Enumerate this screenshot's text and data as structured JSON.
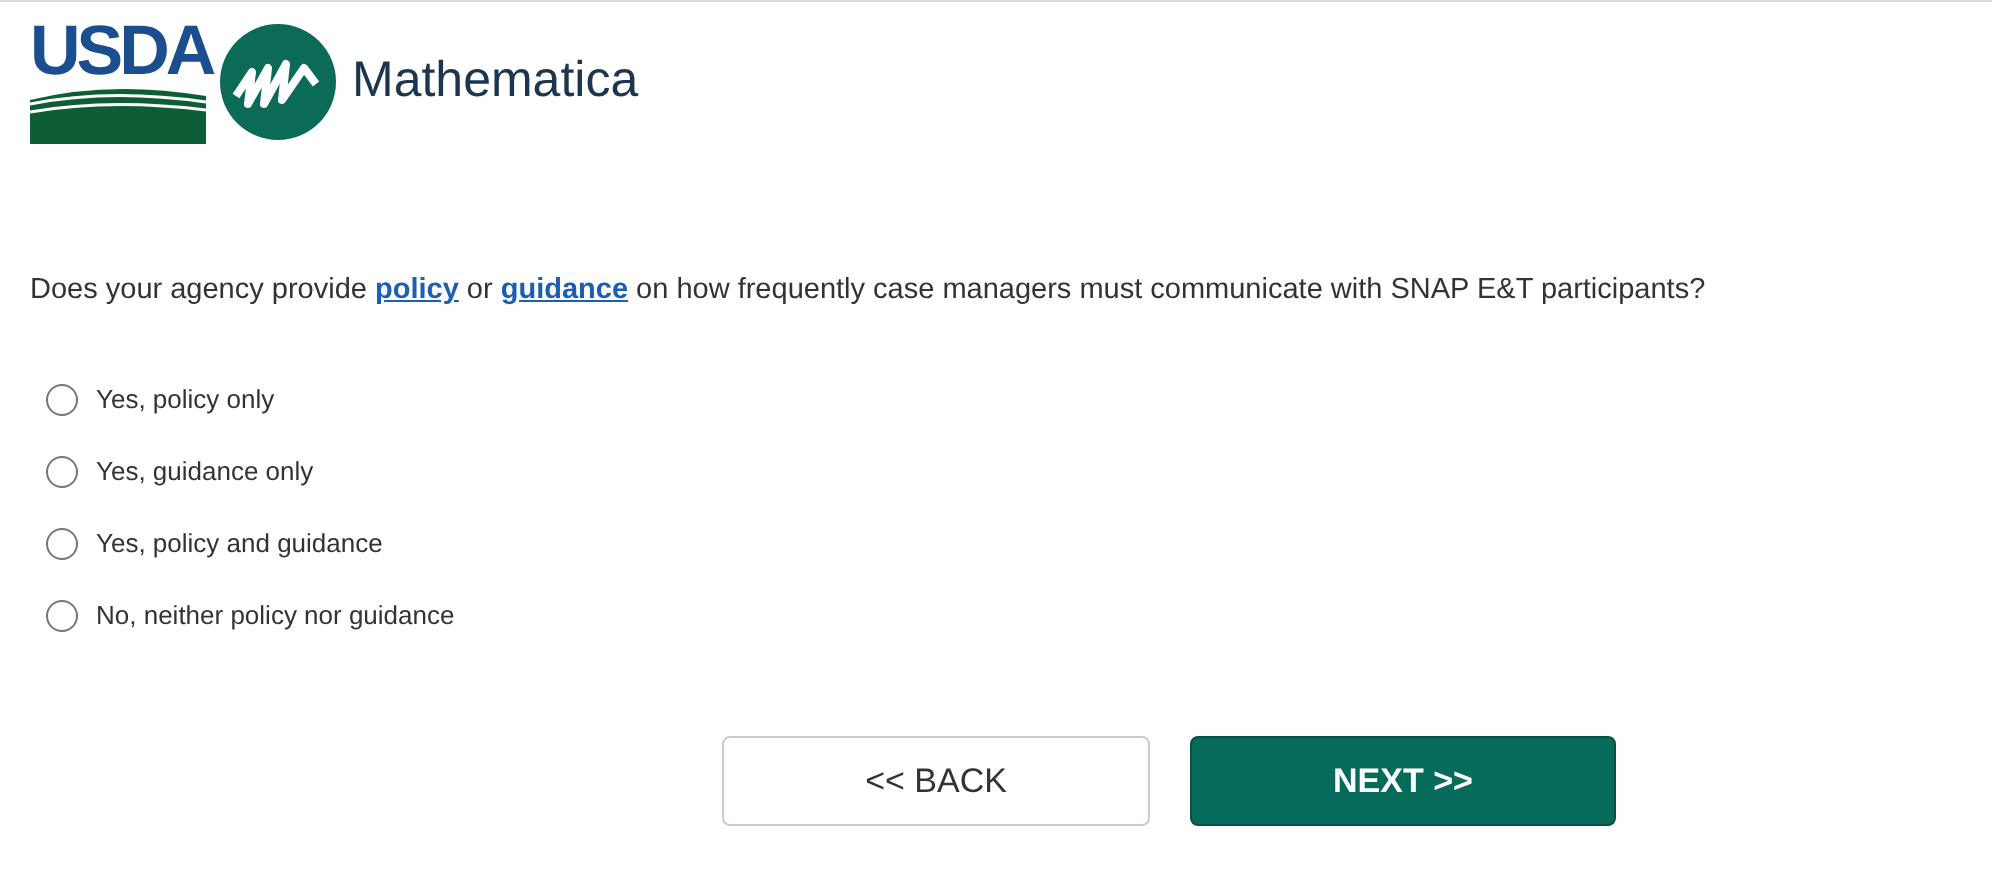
{
  "header": {
    "usda_logo": "USDA",
    "brand": "Mathematica"
  },
  "question": {
    "parts": [
      {
        "kind": "text",
        "text": "Does your agency provide "
      },
      {
        "kind": "link",
        "text": "policy"
      },
      {
        "kind": "text",
        "text": " or "
      },
      {
        "kind": "link",
        "text": "guidance"
      },
      {
        "kind": "text",
        "text": " on how frequently case managers must communicate with SNAP E&T participants?"
      }
    ]
  },
  "options": [
    {
      "label": "Yes, policy only",
      "selected": false
    },
    {
      "label": "Yes, guidance only",
      "selected": false
    },
    {
      "label": "Yes, policy and guidance",
      "selected": false
    },
    {
      "label": "No, neither policy nor guidance",
      "selected": false
    }
  ],
  "buttons": [
    {
      "kind": "back",
      "label": "<< BACK"
    },
    {
      "kind": "next",
      "label": "NEXT >>"
    }
  ]
}
